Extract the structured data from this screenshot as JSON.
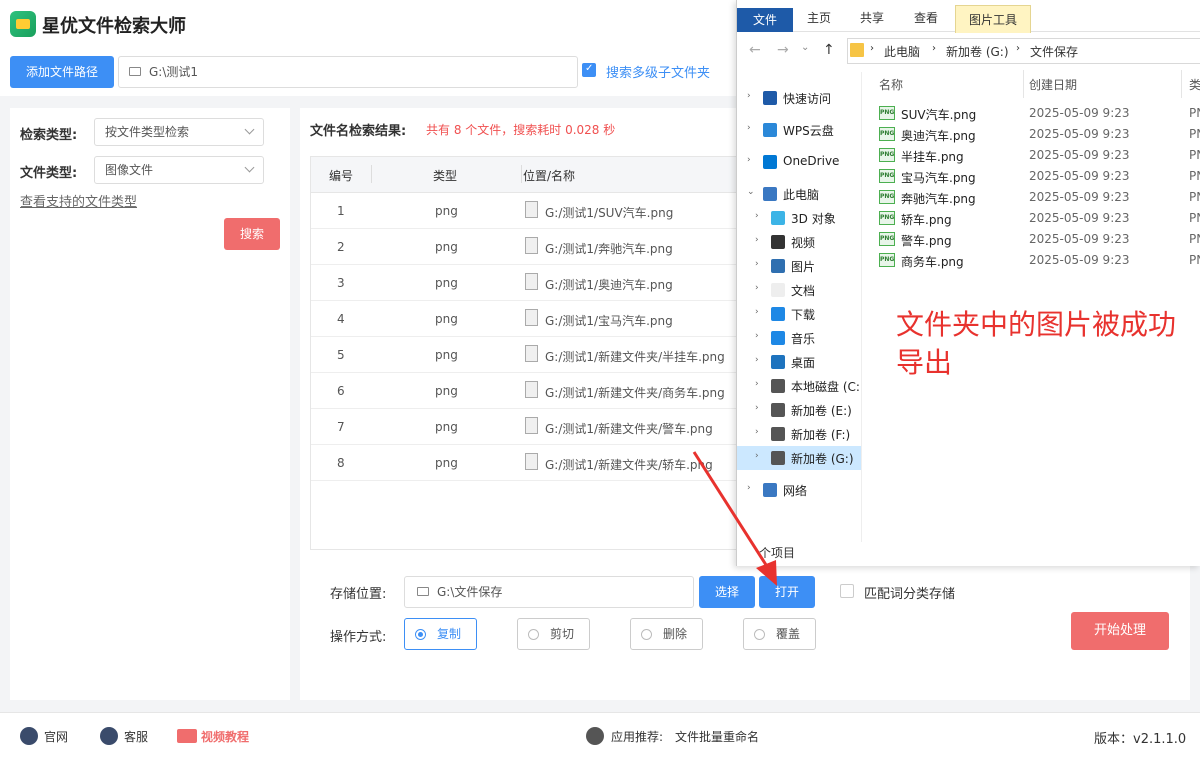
{
  "app": {
    "title": "星优文件检索大师"
  },
  "toolbar": {
    "add_path_label": "添加文件路径",
    "path_value": "G:\\测试1",
    "search_subfolders_label": "搜索多级子文件夹"
  },
  "left": {
    "search_type_label": "检索类型:",
    "search_type_value": "按文件类型检索",
    "file_type_label": "文件类型:",
    "file_type_value": "图像文件",
    "supported_link": "查看支持的文件类型",
    "search_button": "搜索"
  },
  "results": {
    "label": "文件名检索结果:",
    "info": "共有 8 个文件，搜索耗时 0.028 秒",
    "columns": [
      "编号",
      "类型",
      "位置/名称"
    ],
    "rows": [
      {
        "no": "1",
        "type": "png",
        "path": "G:/测试1/SUV汽车.png"
      },
      {
        "no": "2",
        "type": "png",
        "path": "G:/测试1/奔驰汽车.png"
      },
      {
        "no": "3",
        "type": "png",
        "path": "G:/测试1/奥迪汽车.png"
      },
      {
        "no": "4",
        "type": "png",
        "path": "G:/测试1/宝马汽车.png"
      },
      {
        "no": "5",
        "type": "png",
        "path": "G:/测试1/新建文件夹/半挂车.png"
      },
      {
        "no": "6",
        "type": "png",
        "path": "G:/测试1/新建文件夹/商务车.png"
      },
      {
        "no": "7",
        "type": "png",
        "path": "G:/测试1/新建文件夹/警车.png"
      },
      {
        "no": "8",
        "type": "png",
        "path": "G:/测试1/新建文件夹/轿车.png"
      }
    ]
  },
  "bottom": {
    "save_label": "存储位置:",
    "save_value": "G:\\文件保存",
    "choose_button": "选择",
    "open_button": "打开",
    "match_label": "匹配词分类存储",
    "op_label": "操作方式:",
    "ops": [
      "复制",
      "剪切",
      "删除",
      "覆盖"
    ],
    "selected_op": "复制",
    "start_button": "开始处理"
  },
  "footer": {
    "official": "官网",
    "support": "客服",
    "video": "视频教程",
    "recommend_label": "应用推荐:",
    "recommend_value": "文件批量重命名",
    "version": "版本：v2.1.1.0"
  },
  "explorer": {
    "tabs": [
      "文件",
      "主页",
      "共享",
      "查看",
      "图片工具"
    ],
    "breadcrumb": [
      "此电脑",
      "新加卷 (G:)",
      "文件保存"
    ],
    "nav": [
      "快速访问",
      "WPS云盘",
      "OneDrive",
      "此电脑",
      "3D 对象",
      "视频",
      "图片",
      "文档",
      "下载",
      "音乐",
      "桌面",
      "本地磁盘 (C:",
      "新加卷 (E:)",
      "新加卷 (F:)",
      "新加卷 (G:)",
      "网络"
    ],
    "col_name": "名称",
    "col_date": "创建日期",
    "col_type": "类",
    "files": [
      {
        "name": "SUV汽车.png",
        "date": "2025-05-09 9:23",
        "type": "PN"
      },
      {
        "name": "奥迪汽车.png",
        "date": "2025-05-09 9:23",
        "type": "PN"
      },
      {
        "name": "半挂车.png",
        "date": "2025-05-09 9:23",
        "type": "PN"
      },
      {
        "name": "宝马汽车.png",
        "date": "2025-05-09 9:23",
        "type": "PN"
      },
      {
        "name": "奔驰汽车.png",
        "date": "2025-05-09 9:23",
        "type": "PN"
      },
      {
        "name": "轿车.png",
        "date": "2025-05-09 9:23",
        "type": "PN"
      },
      {
        "name": "警车.png",
        "date": "2025-05-09 9:23",
        "type": "PN"
      },
      {
        "name": "商务车.png",
        "date": "2025-05-09 9:23",
        "type": "PN"
      }
    ],
    "status": "个项目",
    "png_badge": "PNG"
  },
  "annotation": "文件夹中的图片被成功导出",
  "colors": {
    "accent": "#3d8ff5",
    "danger": "#f06d6d",
    "annotation": "#e8322e"
  }
}
